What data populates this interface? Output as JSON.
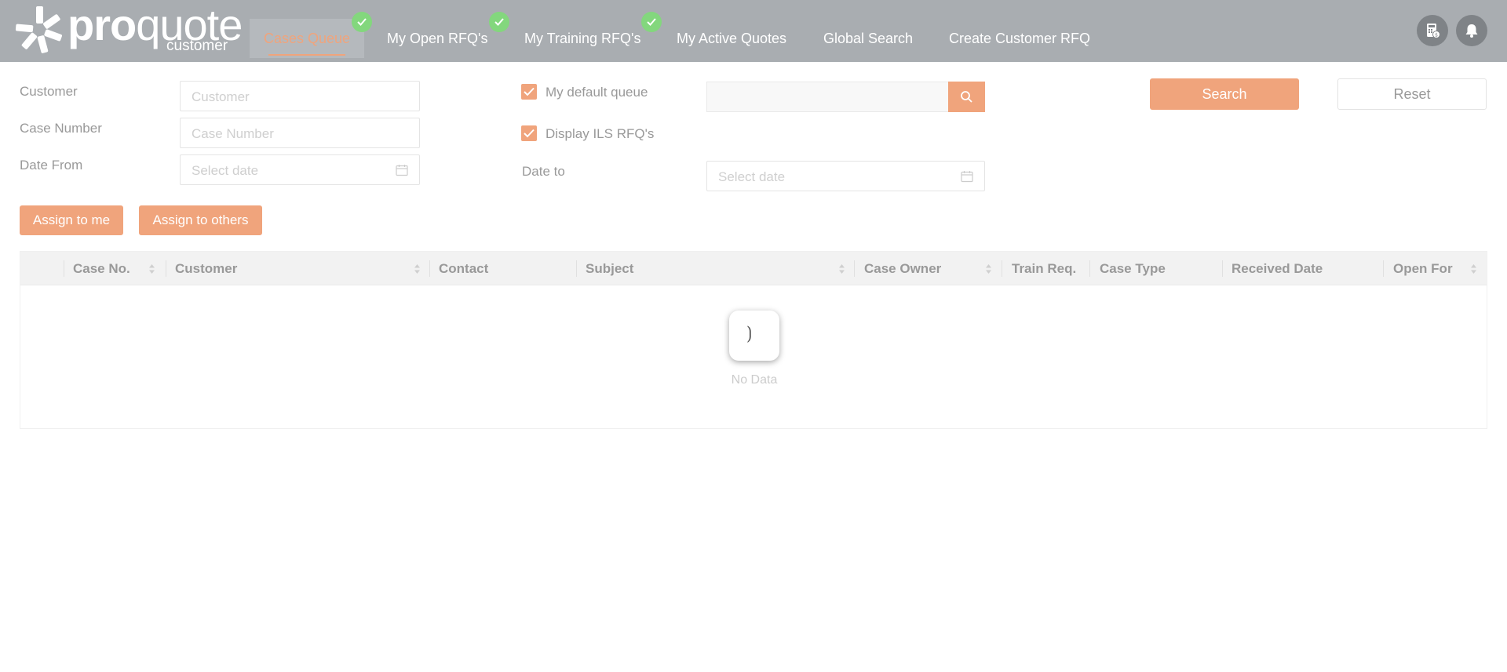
{
  "brand": {
    "logo_word_bold": "pro",
    "logo_word_thin": "quote",
    "logo_sub": "customer"
  },
  "nav": {
    "tabs": [
      {
        "label": "Cases Queue",
        "active": true,
        "badge": "check"
      },
      {
        "label": "My Open RFQ's",
        "active": false,
        "badge": "check"
      },
      {
        "label": "My Training RFQ's",
        "active": false,
        "badge": "check"
      },
      {
        "label": "My Active Quotes",
        "active": false,
        "badge": null
      },
      {
        "label": "Global Search",
        "active": false,
        "badge": null
      },
      {
        "label": "Create Customer RFQ",
        "active": false,
        "badge": null
      }
    ],
    "icons": [
      "calculator-icon",
      "bell-icon"
    ]
  },
  "filters": {
    "customer_label": "Customer",
    "customer_placeholder": "Customer",
    "case_number_label": "Case Number",
    "case_number_placeholder": "Case Number",
    "date_from_label": "Date From",
    "date_from_placeholder": "Select date",
    "date_to_label": "Date to",
    "date_to_placeholder": "Select date",
    "my_default_queue_label": "My default queue",
    "my_default_queue_checked": true,
    "display_ils_label": "Display ILS RFQ's",
    "display_ils_checked": true,
    "queue_search_value": "",
    "search_button": "Search",
    "reset_button": "Reset"
  },
  "actions": {
    "assign_to_me": "Assign to me",
    "assign_to_others": "Assign to others"
  },
  "table": {
    "columns": [
      {
        "label": "Case No.",
        "sortable": true
      },
      {
        "label": "Customer",
        "sortable": true
      },
      {
        "label": "Contact",
        "sortable": false
      },
      {
        "label": "Subject",
        "sortable": true
      },
      {
        "label": "Case Owner",
        "sortable": true
      },
      {
        "label": "Train Req.",
        "sortable": false
      },
      {
        "label": "Case Type",
        "sortable": false
      },
      {
        "label": "Received Date",
        "sortable": false
      },
      {
        "label": "Open For",
        "sortable": true
      }
    ],
    "rows": [],
    "empty_text": "No Data",
    "loading": true
  },
  "colors": {
    "accent": "#f0a47c",
    "header_bg": "#a9adb1",
    "badge_green": "#83d77d"
  }
}
